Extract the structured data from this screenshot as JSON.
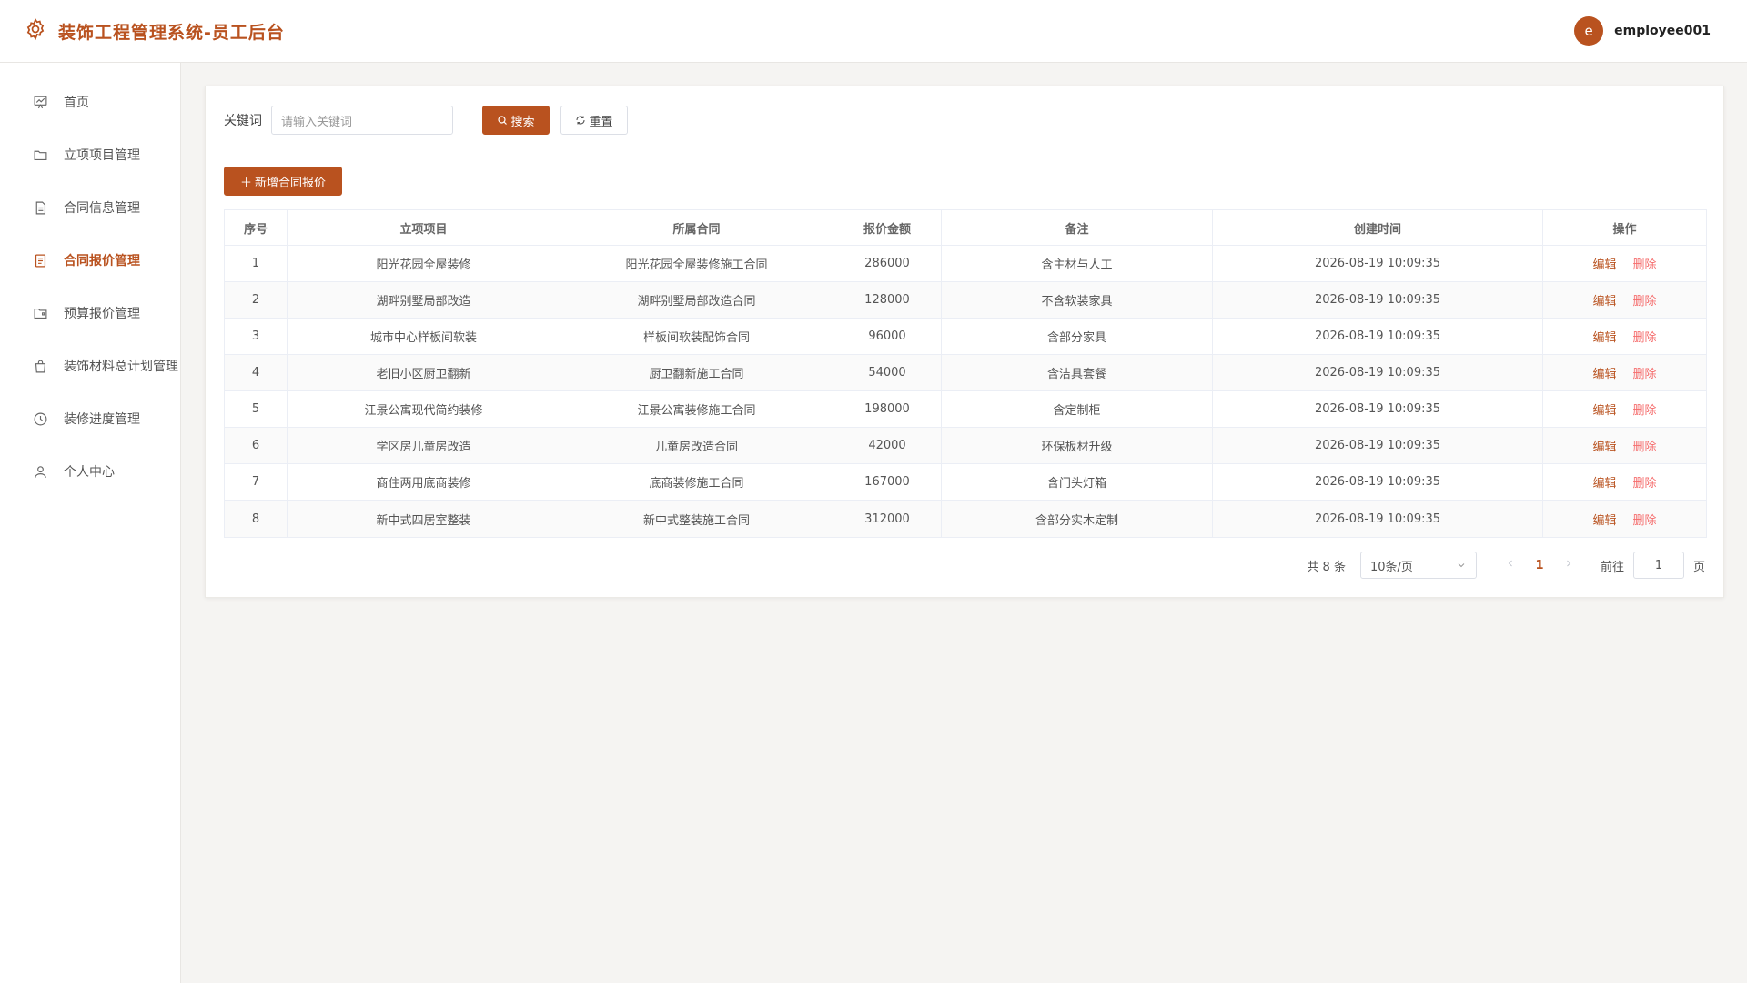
{
  "header": {
    "title": "装饰工程管理系统-员工后台",
    "user": {
      "avatar_letter": "e",
      "name": "employee001"
    }
  },
  "colors": {
    "accent": "#b9521f",
    "danger": "#f56c6c"
  },
  "sidebar": {
    "items": [
      {
        "label": "首页",
        "icon": "chart-board-icon",
        "active": false
      },
      {
        "label": "立项项目管理",
        "icon": "folder-icon",
        "active": false
      },
      {
        "label": "合同信息管理",
        "icon": "document-icon",
        "active": false
      },
      {
        "label": "合同报价管理",
        "icon": "list-document-icon",
        "active": true
      },
      {
        "label": "预算报价管理",
        "icon": "folder-open-icon",
        "active": false
      },
      {
        "label": "装饰材料总计划管理",
        "icon": "shopping-bag-icon",
        "active": false
      },
      {
        "label": "装修进度管理",
        "icon": "clock-icon",
        "active": false
      },
      {
        "label": "个人中心",
        "icon": "user-icon",
        "active": false
      }
    ]
  },
  "search": {
    "label": "关键词",
    "placeholder": "请输入关键词",
    "search_label": "搜索",
    "reset_label": "重置"
  },
  "toolbar": {
    "add_label": "新增合同报价"
  },
  "table": {
    "columns": [
      "序号",
      "立项项目",
      "所属合同",
      "报价金额",
      "备注",
      "创建时间",
      "操作"
    ],
    "edit_label": "编辑",
    "delete_label": "删除",
    "rows": [
      {
        "no": "1",
        "project": "阳光花园全屋装修",
        "contract": "阳光花园全屋装修施工合同",
        "amount": "286000",
        "remark": "含主材与人工",
        "created": "2026-08-19 10:09:35"
      },
      {
        "no": "2",
        "project": "湖畔别墅局部改造",
        "contract": "湖畔别墅局部改造合同",
        "amount": "128000",
        "remark": "不含软装家具",
        "created": "2026-08-19 10:09:35"
      },
      {
        "no": "3",
        "project": "城市中心样板间软装",
        "contract": "样板间软装配饰合同",
        "amount": "96000",
        "remark": "含部分家具",
        "created": "2026-08-19 10:09:35"
      },
      {
        "no": "4",
        "project": "老旧小区厨卫翻新",
        "contract": "厨卫翻新施工合同",
        "amount": "54000",
        "remark": "含洁具套餐",
        "created": "2026-08-19 10:09:35"
      },
      {
        "no": "5",
        "project": "江景公寓现代简约装修",
        "contract": "江景公寓装修施工合同",
        "amount": "198000",
        "remark": "含定制柜",
        "created": "2026-08-19 10:09:35"
      },
      {
        "no": "6",
        "project": "学区房儿童房改造",
        "contract": "儿童房改造合同",
        "amount": "42000",
        "remark": "环保板材升级",
        "created": "2026-08-19 10:09:35"
      },
      {
        "no": "7",
        "project": "商住两用底商装修",
        "contract": "底商装修施工合同",
        "amount": "167000",
        "remark": "含门头灯箱",
        "created": "2026-08-19 10:09:35"
      },
      {
        "no": "8",
        "project": "新中式四居室整装",
        "contract": "新中式整装施工合同",
        "amount": "312000",
        "remark": "含部分实木定制",
        "created": "2026-08-19 10:09:35"
      }
    ]
  },
  "pagination": {
    "total_text": "共 8 条",
    "page_size": "10条/页",
    "current_page": "1",
    "goto_label": "前往",
    "goto_value": "1",
    "page_suffix": "页"
  }
}
